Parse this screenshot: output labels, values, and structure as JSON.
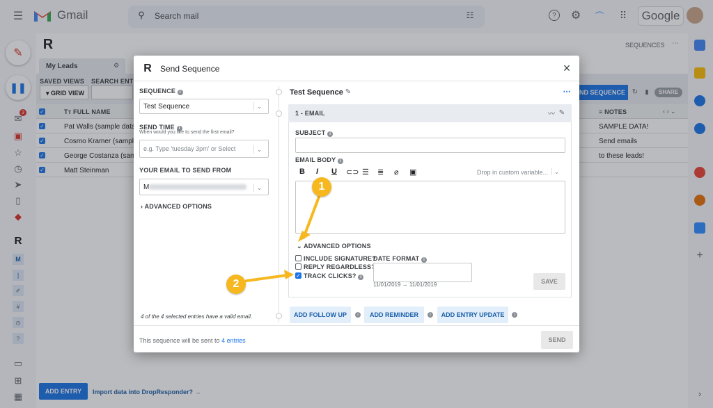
{
  "gmail": {
    "title": "Gmail",
    "search_placeholder": "Search mail",
    "google_label": "Google"
  },
  "background": {
    "sequences_link": "SEQUENCES",
    "tab_my_leads": "My Leads",
    "saved_views": "SAVED VIEWS",
    "search_entries": "SEARCH ENTRI",
    "grid_view": "GRID VIEW",
    "send_sequence_btn": "ND SEQUENCE",
    "share_btn": "SHARE",
    "col_full_name": "FULL NAME",
    "col_notes": "NOTES",
    "rows": [
      {
        "name": "Pat Walls (sample data)",
        "note": "SAMPLE DATA!"
      },
      {
        "name": "Cosmo Kramer (sample da",
        "note": "Send emails"
      },
      {
        "name": "George Costanza (sample",
        "note": "to these leads!"
      },
      {
        "name": "Matt Steinman",
        "note": ""
      }
    ],
    "add_entry": "ADD ENTRY",
    "import_link": "Import data into DropResponder? →",
    "mail_badge": "3"
  },
  "modal": {
    "title": "Send Sequence",
    "left": {
      "sequence_label": "SEQUENCE",
      "sequence_value": "Test Sequence",
      "send_time_label": "SEND TIME",
      "send_time_hint": "When would you like to send the first email?",
      "send_time_placeholder": "e.g. Type 'tuesday 3pm' or Select",
      "from_label": "YOUR EMAIL TO SEND FROM",
      "from_value": "M",
      "advanced_options": "ADVANCED OPTIONS",
      "valid_note": "4 of the 4 selected entries have a valid email.",
      "footer_text": "This sequence will be sent to",
      "footer_link": "4 entries"
    },
    "right": {
      "sequence_title": "Test Sequence",
      "step_header": "1 - EMAIL",
      "subject_label": "SUBJECT",
      "body_label": "EMAIL BODY",
      "custom_var": "Drop in custom variable...",
      "advanced_options": "ADVANCED OPTIONS",
      "include_signature": "INCLUDE SIGNATURE?",
      "reply_regardless": "REPLY REGARDLESS?",
      "track_clicks": "TRACK CLICKS?",
      "date_format_label": "DATE FORMAT",
      "date_preview": "11/01/2019 → 11/01/2019",
      "save_btn": "SAVE",
      "add_follow_up": "ADD FOLLOW UP",
      "add_reminder": "ADD REMINDER",
      "add_entry_update": "ADD ENTRY UPDATE",
      "send_btn": "SEND"
    }
  },
  "callouts": {
    "one": "1",
    "two": "2"
  },
  "colors": {
    "accent": "#1a73e8",
    "callout": "#f6b81e",
    "header_bg": "#e8ebf0"
  }
}
